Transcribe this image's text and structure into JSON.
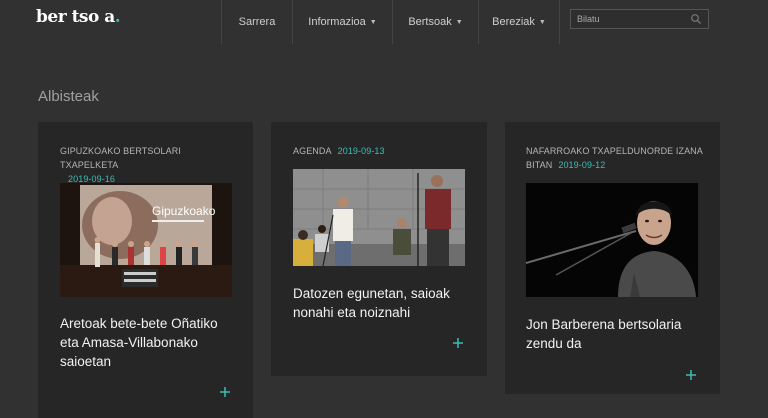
{
  "header": {
    "logo_main": "ber tso a",
    "logo_dot": ".",
    "nav": [
      {
        "label": "Sarrera",
        "dropdown": false
      },
      {
        "label": "Informazioa",
        "dropdown": true
      },
      {
        "label": "Bertsoak",
        "dropdown": true
      },
      {
        "label": "Bereziak",
        "dropdown": true
      }
    ],
    "search_placeholder": "Bilatu"
  },
  "section": {
    "title": "Albisteak"
  },
  "colors": {
    "background": "#313131",
    "card": "#262626",
    "accent": "#3cbdb3"
  },
  "cards": [
    {
      "category": "GIPUZKOAKO BERTSOLARI TXAPELKETA",
      "date": "2019-09-16",
      "image_text": "Gipuzkoako",
      "title": "Aretoak bete-bete Oñatiko eta Amasa-Villabonako saioetan",
      "more_icon": "plus-icon"
    },
    {
      "category": "AGENDA",
      "date": "2019-09-13",
      "title": "Datozen egunetan, saioak nonahi eta noiznahi",
      "more_icon": "plus-icon"
    },
    {
      "category": "NAFARROAKO TXAPELDUNORDE IZANA BITAN",
      "date": "2019-09-12",
      "title": "Jon Barberena bertsolaria zendu da",
      "more_icon": "plus-icon"
    }
  ]
}
